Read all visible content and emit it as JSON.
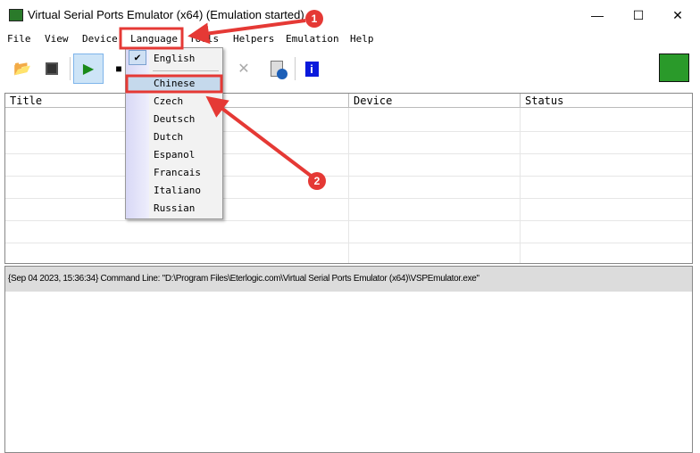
{
  "window": {
    "title": "Virtual Serial Ports Emulator (x64) (Emulation started)",
    "minimize": "—",
    "maximize": "☐",
    "close": "✕"
  },
  "menubar": [
    "File",
    "View",
    "Device",
    "Language",
    "Tools",
    "Helpers",
    "Emulation",
    "Help"
  ],
  "language_menu": {
    "items": [
      "English",
      "Chinese",
      "Czech",
      "Deutsch",
      "Dutch",
      "Espanol",
      "Francais",
      "Italiano",
      "Russian"
    ],
    "checked": "English",
    "highlighted": "Chinese"
  },
  "table": {
    "columns": [
      "Title",
      "Device",
      "Status"
    ],
    "rows": []
  },
  "log": [
    "{Sep 04 2023, 15:36:34} Command Line: \"D:\\Program Files\\Eterlogic.com\\Virtual Serial Ports Emulator (x64)\\VSPEmulator.exe\""
  ],
  "annotations": {
    "step1": "1",
    "step2": "2",
    "color": "#e53935"
  }
}
